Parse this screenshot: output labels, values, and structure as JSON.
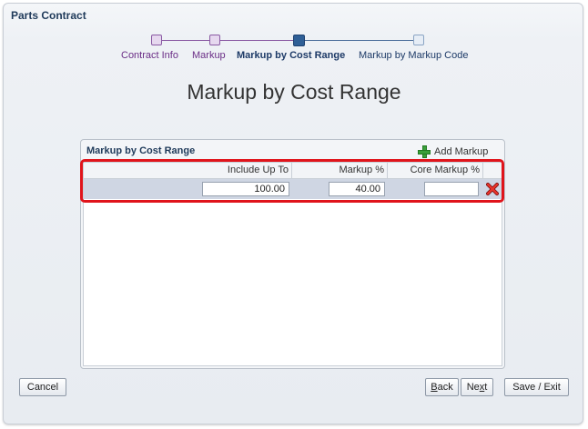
{
  "app": {
    "title": "Parts Contract"
  },
  "train": {
    "steps": [
      {
        "label": "Contract Info",
        "state": "visited"
      },
      {
        "label": "Markup",
        "state": "visited"
      },
      {
        "label": "Markup by Cost Range",
        "state": "current"
      },
      {
        "label": "Markup by Markup Code",
        "state": "pending"
      }
    ]
  },
  "page": {
    "title": "Markup by Cost Range"
  },
  "panel": {
    "title": "Markup by Cost Range",
    "add_label": "Add Markup",
    "columns": [
      "Include Up To",
      "Markup %",
      "Core Markup %"
    ],
    "rows": [
      {
        "include_up_to": "100.00",
        "markup_pct": "40.00",
        "core_markup_pct": ""
      }
    ]
  },
  "footer": {
    "cancel": "Cancel",
    "back_prefix": "",
    "back_u": "B",
    "back_rest": "ack",
    "next_prefix": "Ne",
    "next_u": "x",
    "next_rest": "t",
    "save_exit": "Save / Exit"
  },
  "colors": {
    "highlight": "#e0141b",
    "current_step": "#2f5f96",
    "visited_step": "#6a2d86"
  },
  "icons": {
    "add": "plus-icon",
    "delete": "delete-x-icon"
  }
}
